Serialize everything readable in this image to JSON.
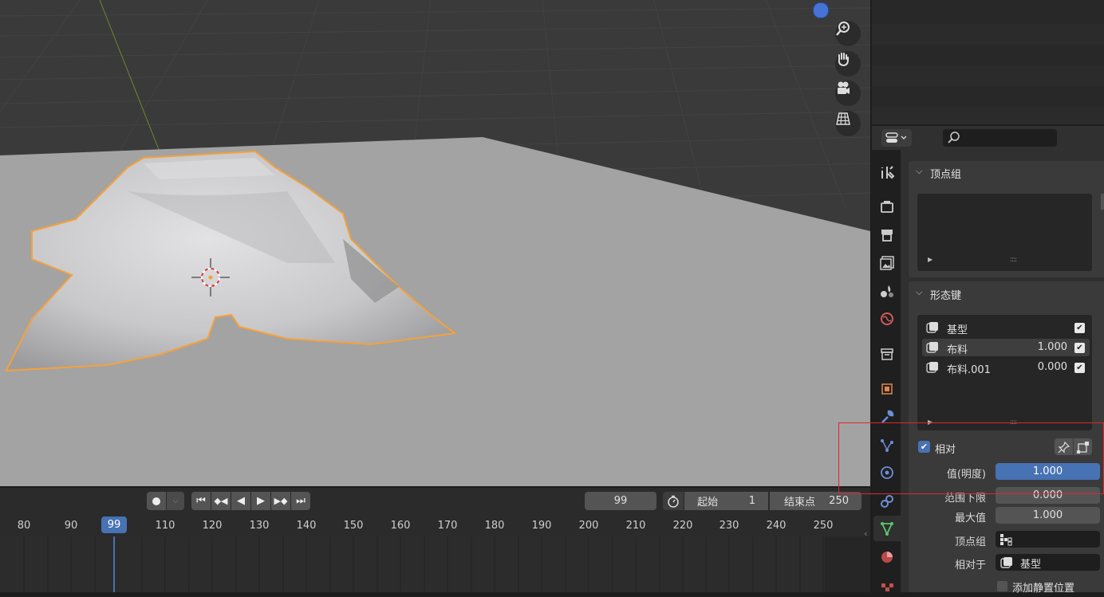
{
  "timeline": {
    "current_frame": "99",
    "start_label": "起始",
    "start_value": "1",
    "end_label": "结束点",
    "end_value": "250",
    "playhead": "99",
    "ticks": [
      "80",
      "90",
      "110",
      "120",
      "130",
      "140",
      "150",
      "160",
      "170",
      "180",
      "190",
      "200",
      "210",
      "220",
      "230",
      "240",
      "250"
    ]
  },
  "properties": {
    "search_placeholder": "",
    "vertex_groups": {
      "title": "顶点组"
    },
    "shape_keys": {
      "title": "形态键",
      "items": [
        {
          "name": "基型",
          "value": ""
        },
        {
          "name": "布料",
          "value": "1.000"
        },
        {
          "name": "布料.001",
          "value": "0.000"
        }
      ],
      "relative_label": "相对",
      "value_label": "值(明度)",
      "value": "1.000",
      "range_min_label": "范围下限",
      "range_min": "0.000",
      "max_label": "最大值",
      "max": "1.000",
      "vertex_group_label": "顶点组",
      "relative_to_label": "相对于",
      "relative_to": "基型",
      "add_rest_label": "添加静置位置"
    }
  },
  "colors": {
    "accent": "#4772b3",
    "selection_outline": "#f5a13c",
    "highlight_box": "#e0262b"
  }
}
